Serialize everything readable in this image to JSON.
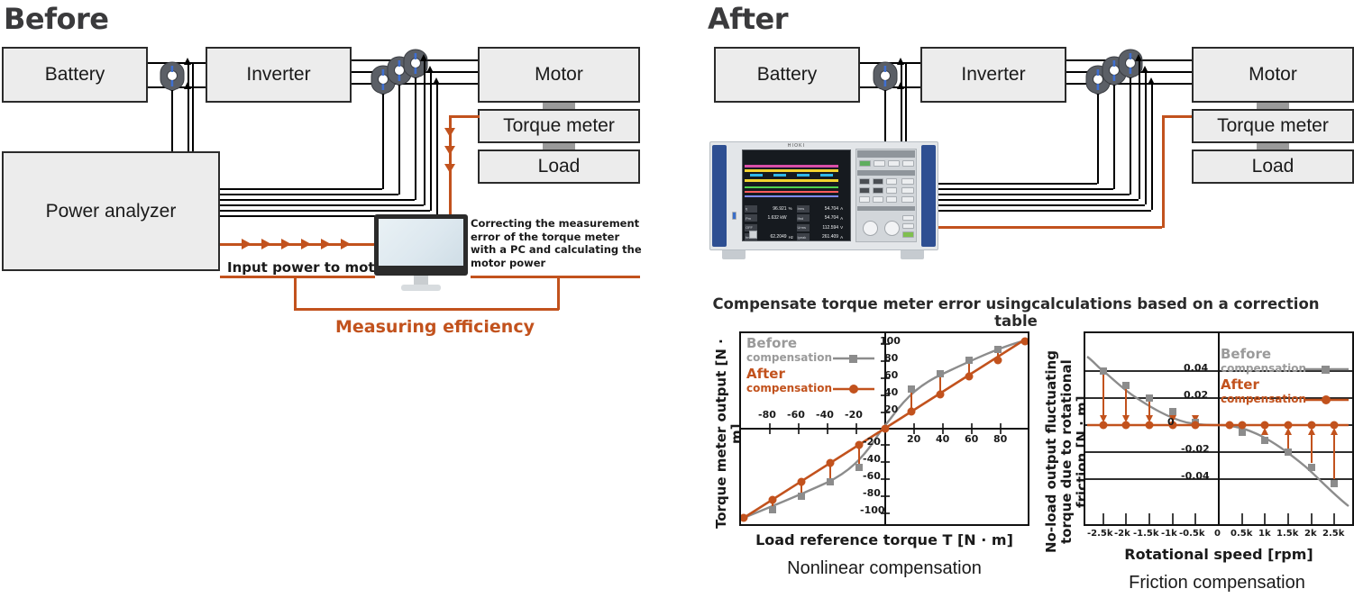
{
  "panels": {
    "before": {
      "title": "Before",
      "blocks": {
        "battery": "Battery",
        "inverter": "Inverter",
        "motor": "Motor",
        "torque_meter": "Torque meter",
        "load": "Load",
        "power_analyzer": "Power analyzer"
      },
      "note": "Correcting the measurement error of the torque meter with a PC and calculating the motor power",
      "input_power_label": "Input power to motor",
      "measuring_efficiency_label": "Measuring efficiency"
    },
    "after": {
      "title": "After",
      "blocks": {
        "battery": "Battery",
        "inverter": "Inverter",
        "motor": "Motor",
        "torque_meter": "Torque meter",
        "load": "Load"
      },
      "caption": "Compensate torque meter error usingcalculations based on a correction table",
      "analyzer": {
        "brand": "HIOKI",
        "readouts": [
          {
            "tag": "η",
            "value": "96.921",
            "unit": "%"
          },
          {
            "tag": "Pm",
            "value": "1.632 kW",
            "unit": ""
          },
          {
            "tag": "OFF",
            "value": "",
            "unit": ""
          },
          {
            "tag": "fm",
            "value": "62.2049",
            "unit": "Hz"
          }
        ],
        "readouts_right": [
          {
            "tag": "Irms",
            "value": "54.704",
            "unit": "A"
          },
          {
            "tag": "Ifnd",
            "value": "54.704",
            "unit": "A"
          },
          {
            "tag": "Urms",
            "value": "112.594",
            "unit": "V"
          },
          {
            "tag": "Ipeak",
            "value": "261.409",
            "unit": "A"
          }
        ]
      }
    }
  },
  "colors": {
    "accent_orange": "#c2521d",
    "before_gray": "#8c8c8c",
    "block_fill": "#ececec",
    "block_border": "#2b2b2b"
  },
  "chart_data": [
    {
      "id": "nonlinear",
      "type": "line",
      "title": "Nonlinear compensation",
      "xlabel": "Load reference torque T [N · m]",
      "ylabel": "Torque meter output [N · m]",
      "xlim": [
        -100,
        100
      ],
      "ylim": [
        -110,
        110
      ],
      "xticks": [
        -80,
        -60,
        -40,
        -20,
        20,
        40,
        60,
        80
      ],
      "xticklabels": [
        "-80",
        "-60",
        "-40",
        "-20",
        "20",
        "40",
        "60",
        "80"
      ],
      "yticks": [
        100,
        80,
        60,
        40,
        20,
        -20,
        -40,
        -60,
        -80,
        -100
      ],
      "yticklabels": [
        "100",
        "80",
        "60",
        "40",
        "20",
        "-20",
        "-40",
        "-60",
        "-80",
        "-100"
      ],
      "grid": false,
      "legend_position": "top-left",
      "series": [
        {
          "name": "Before compensation",
          "label_line1": "Before",
          "label_line2": "compensation",
          "color": "#8c8c8c",
          "marker": "square",
          "x": [
            -98,
            -80,
            -60,
            -40,
            -20,
            0,
            20,
            40,
            60,
            80,
            98
          ],
          "y": [
            -104,
            -88,
            -72,
            -57,
            -40,
            0,
            44,
            66,
            82,
            95,
            104
          ]
        },
        {
          "name": "After compensation",
          "label_line1": "After",
          "label_line2": "compensation",
          "color": "#c2521d",
          "marker": "circle",
          "x": [
            -98,
            -80,
            -60,
            -40,
            -20,
            0,
            20,
            40,
            60,
            80,
            98
          ],
          "y": [
            -103,
            -83,
            -63,
            -42,
            -21,
            0,
            22,
            42,
            63,
            83,
            103
          ]
        }
      ]
    },
    {
      "id": "friction",
      "type": "line",
      "title": "Friction compensation",
      "xlabel": "Rotational speed [rpm]",
      "ylabel": "No-load output fluctuating torque due to rotational friction [N · m]",
      "xlim": [
        -2750,
        2750
      ],
      "ylim": [
        -0.058,
        0.058
      ],
      "xticks": [
        -2500,
        -2000,
        -1500,
        -1000,
        -500,
        0,
        500,
        1000,
        1500,
        2000,
        2500
      ],
      "xticklabels": [
        "-2.5k",
        "-2k",
        "-1.5k",
        "-1k",
        "-0.5k",
        "0",
        "0.5k",
        "1k",
        "1.5k",
        "2k",
        "2.5k"
      ],
      "yticks": [
        0.04,
        0.02,
        0,
        -0.02,
        -0.04
      ],
      "yticklabels": [
        "0.04",
        "0.02",
        "0",
        "-0.02",
        "-0.04"
      ],
      "grid": true,
      "legend_position": "top-right",
      "series": [
        {
          "name": "Before compensation",
          "label_line1": "Before",
          "label_line2": "compensation",
          "color": "#8c8c8c",
          "marker": "square",
          "x": [
            -2500,
            -2000,
            -1500,
            -1000,
            -500,
            0,
            500,
            1000,
            1500,
            2000,
            2500
          ],
          "y": [
            0.04,
            0.026,
            0.016,
            0.007,
            0.001,
            0.0,
            -0.003,
            -0.008,
            -0.017,
            -0.027,
            -0.04
          ]
        },
        {
          "name": "After compensation",
          "label_line1": "After",
          "label_line2": "compensation",
          "color": "#c2521d",
          "marker": "circle",
          "x": [
            -2500,
            -2000,
            -1500,
            -1000,
            -500,
            0,
            500,
            1000,
            1500,
            2000,
            2500
          ],
          "y": [
            0,
            0,
            0,
            0,
            0,
            0,
            0,
            0,
            0,
            0,
            0
          ]
        }
      ]
    }
  ]
}
